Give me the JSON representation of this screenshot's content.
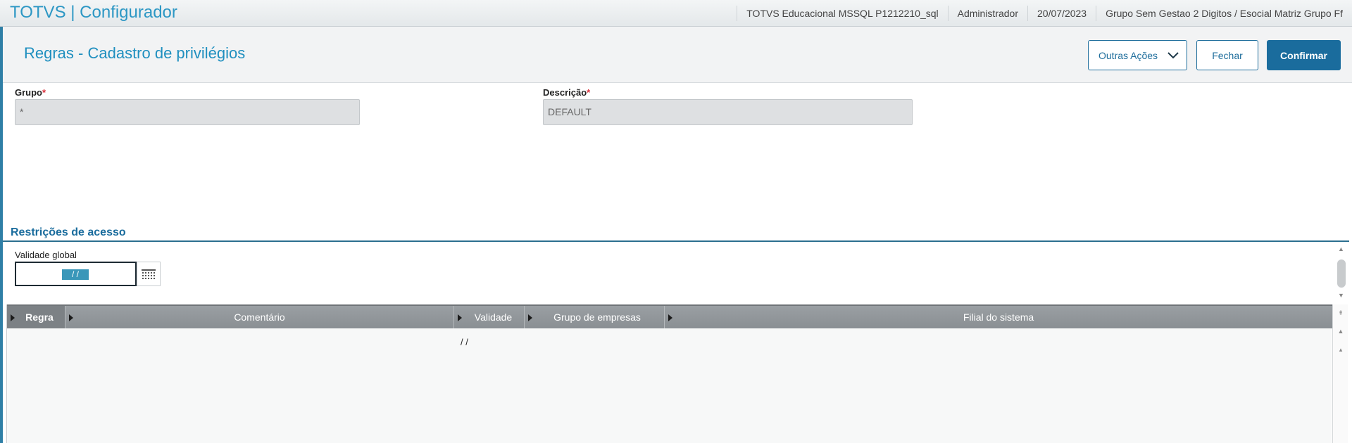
{
  "topbar": {
    "app_title": "TOTVS | Configurador",
    "environment": "TOTVS Educacional MSSQL P1212210_sql",
    "user": "Administrador",
    "date": "20/07/2023",
    "company": "Grupo Sem Gestao 2 Digitos / Esocial Matriz Grupo Ff"
  },
  "header": {
    "title": "Regras - Cadastro de privilégios",
    "more_actions_label": "Outras Ações",
    "close_label": "Fechar",
    "confirm_label": "Confirmar"
  },
  "form": {
    "grupo_label": "Grupo",
    "grupo_value": "*",
    "descricao_label": "Descrição",
    "descricao_value": "DEFAULT",
    "required_mark": "*"
  },
  "section": {
    "title": "Restrições de acesso",
    "validade_global_label": "Validade global",
    "validade_global_value": "/ /"
  },
  "grid": {
    "columns": [
      "Regra",
      "Comentário",
      "Validade",
      "Grupo de empresas",
      "Filial do sistema"
    ],
    "rows": [
      {
        "regra": "",
        "comentario": "",
        "validade": "/ /",
        "grupo_empresas": "",
        "filial": ""
      }
    ]
  },
  "colors": {
    "brand": "#2c97c4",
    "primary_button": "#1a6c9d",
    "header_grid": "#8a8f93"
  }
}
